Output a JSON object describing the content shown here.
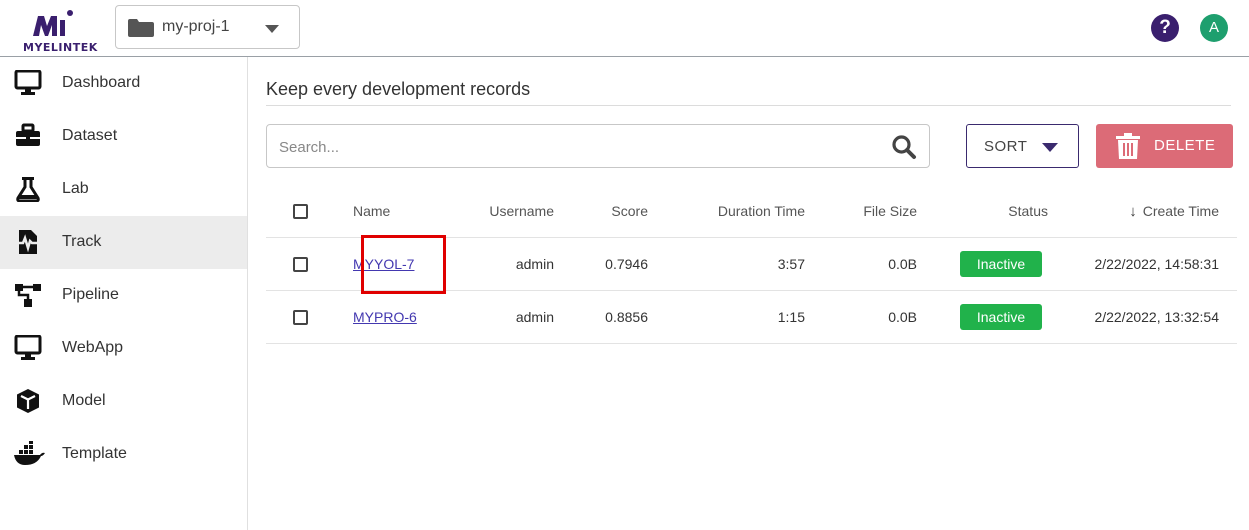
{
  "brand": {
    "name": "MYELINTEK",
    "primary_color": "#3a1f6e"
  },
  "project_selector": {
    "value": "my-proj-1",
    "icon": "folder-icon"
  },
  "header": {
    "help_icon": "question-circle-icon",
    "avatar_initial": "A"
  },
  "sidebar": {
    "items": [
      {
        "label": "Dashboard",
        "icon": "monitor-icon"
      },
      {
        "label": "Dataset",
        "icon": "toolbox-icon"
      },
      {
        "label": "Lab",
        "icon": "flask-icon"
      },
      {
        "label": "Track",
        "icon": "file-waveform-icon",
        "active": true
      },
      {
        "label": "Pipeline",
        "icon": "pipeline-icon"
      },
      {
        "label": "WebApp",
        "icon": "monitor-icon"
      },
      {
        "label": "Model",
        "icon": "cube-icon"
      },
      {
        "label": "Template",
        "icon": "docker-whale-icon"
      }
    ]
  },
  "main": {
    "title": "Keep every development records",
    "search": {
      "placeholder": "Search...",
      "value": ""
    },
    "sort_label": "SORT",
    "delete_label": "DELETE",
    "delete_color": "#dc6b77"
  },
  "table": {
    "columns": [
      "Name",
      "Username",
      "Score",
      "Duration Time",
      "File Size",
      "Status",
      "Create Time"
    ],
    "sort_column": "Create Time",
    "sort_direction": "descending",
    "rows": [
      {
        "name": "MYYOL-7",
        "username": "admin",
        "score": "0.7946",
        "duration": "3:57",
        "file_size": "0.0B",
        "status": "Inactive",
        "create_time": "2/22/2022, 14:58:31",
        "highlighted": true
      },
      {
        "name": "MYPRO-6",
        "username": "admin",
        "score": "0.8856",
        "duration": "1:15",
        "file_size": "0.0B",
        "status": "Inactive",
        "create_time": "2/22/2022, 13:32:54",
        "highlighted": false
      }
    ],
    "status_color": "#21b24b"
  }
}
